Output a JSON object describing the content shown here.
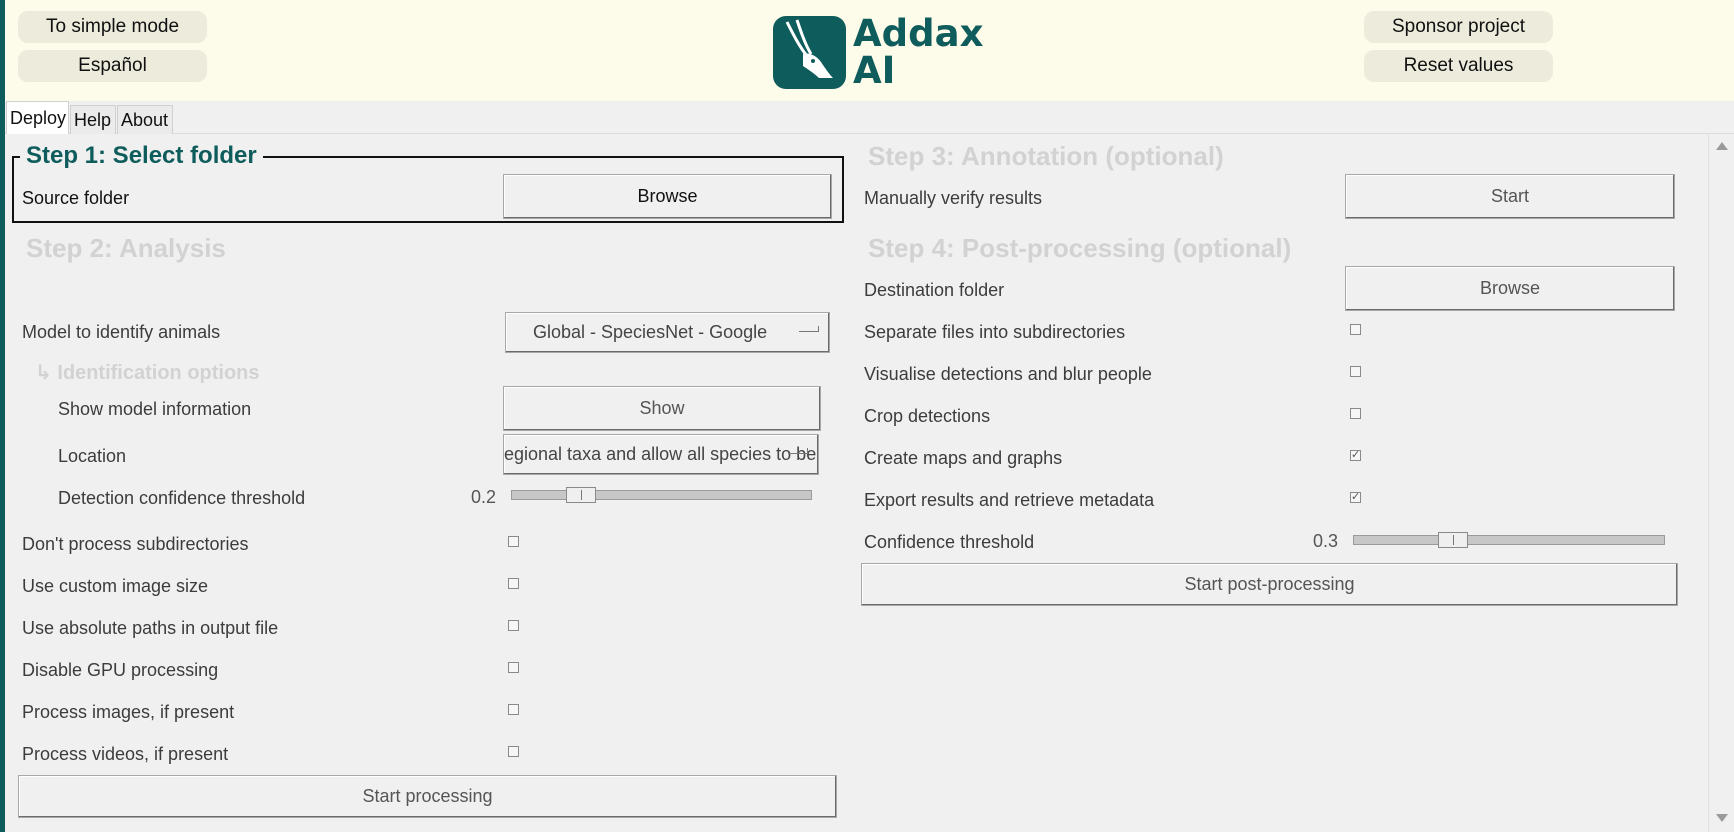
{
  "header": {
    "simple_mode": "To simple mode",
    "language": "Español",
    "sponsor": "Sponsor project",
    "reset": "Reset values",
    "logo_line1": "Addax",
    "logo_line2": "AI"
  },
  "tabs": [
    "Deploy",
    "Help",
    "About"
  ],
  "step1": {
    "title": "Step 1: Select folder",
    "source_label": "Source folder",
    "browse": "Browse"
  },
  "step2": {
    "title": "Step 2: Analysis",
    "model_label": "Model to identify animals",
    "model_value": "Global - SpeciesNet - Google",
    "id_options_title": "↳ Identification options",
    "show_info_label": "Show model information",
    "show_button": "Show",
    "location_label": "Location",
    "location_value": "egional taxa and allow all species to be",
    "det_conf_label": "Detection confidence threshold",
    "det_conf_value": "0.2",
    "det_conf_fraction": 0.2,
    "options": [
      {
        "label": "Don't process subdirectories",
        "checked": false
      },
      {
        "label": "Use custom image size",
        "checked": false
      },
      {
        "label": "Use absolute paths in output file",
        "checked": false
      },
      {
        "label": "Disable GPU processing",
        "checked": false
      },
      {
        "label": "Process images, if present",
        "checked": false
      },
      {
        "label": "Process videos, if present",
        "checked": false
      }
    ],
    "start": "Start processing"
  },
  "step3": {
    "title": "Step 3: Annotation (optional)",
    "verify_label": "Manually verify results",
    "start": "Start"
  },
  "step4": {
    "title": "Step 4: Post-processing (optional)",
    "dest_label": "Destination folder",
    "browse": "Browse",
    "options": [
      {
        "label": "Separate files into subdirectories",
        "checked": false
      },
      {
        "label": "Visualise detections and blur people",
        "checked": false
      },
      {
        "label": "Crop detections",
        "checked": false
      },
      {
        "label": "Create maps and graphs",
        "checked": true
      },
      {
        "label": "Export results and retrieve metadata",
        "checked": true
      }
    ],
    "conf_label": "Confidence threshold",
    "conf_value": "0.3",
    "conf_fraction": 0.3,
    "start": "Start post-processing"
  },
  "colors": {
    "brand": "#0f5c5c",
    "header_bg": "#fdfbea",
    "disabled_title": "#d2d2d2"
  }
}
